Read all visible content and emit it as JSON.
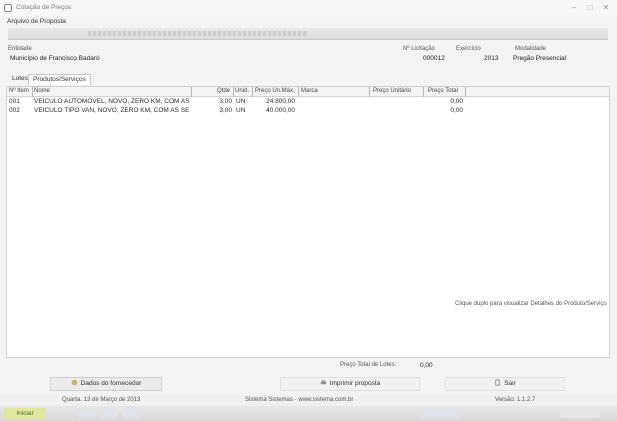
{
  "window": {
    "title": "Cotação de Preços"
  },
  "menu": {
    "file_label": "Arquivo de Proposta"
  },
  "header": {
    "entidade_label": "Entidade",
    "entidade_value": "Município de Francisco Badaró",
    "licitacao_label": "Nº Licitação",
    "licitacao_value": "000012",
    "exercicio_label": "Exercício",
    "exercicio_value": "2013",
    "modalidade_label": "Modalidade",
    "modalidade_value": "Pregão Presencial"
  },
  "tabs": [
    {
      "label": "Lotes",
      "active": false
    },
    {
      "label": "Produtos/Serviços",
      "active": true
    }
  ],
  "grid": {
    "columns": [
      "Nº Item",
      "Nome",
      "Qtde",
      "Unid.",
      "Preço Un.Máx.",
      "Marca",
      "Preço Unitário",
      "Preço Total"
    ],
    "rows": [
      {
        "item": "001",
        "nome": "VEÍCULO AUTOMÓVEL, NOVO, ZERO KM, COM AS",
        "qtde": "3,00",
        "unid": "UN",
        "preco_max": "24.800,00",
        "marca": "",
        "preco_unit": "",
        "preco_total": "0,00"
      },
      {
        "item": "002",
        "nome": "VEÍCULO TIPO VAN, NOVO, ZERO KM, COM AS SE",
        "qtde": "3,00",
        "unid": "UN",
        "preco_max": "40.000,00",
        "marca": "",
        "preco_unit": "",
        "preco_total": "0,00"
      }
    ]
  },
  "hint": "Clique duplo para visualizar Detalhes do Produto/Serviço",
  "totals": {
    "label": "Preço Total de Lotes:",
    "value": "0,00"
  },
  "buttons": {
    "dados_fornecedor": "Dados do fornecedor",
    "imprimir_proposta": "Imprimir proposta",
    "sair": "Sair"
  },
  "status": {
    "date": "Quarta, 13 de Março de 2013",
    "company": "Sistema Sistemas - www.sistema.com.br",
    "version": "Versão: 1.1.2.7"
  },
  "taskbar": {
    "start_label": "Iniciar"
  }
}
